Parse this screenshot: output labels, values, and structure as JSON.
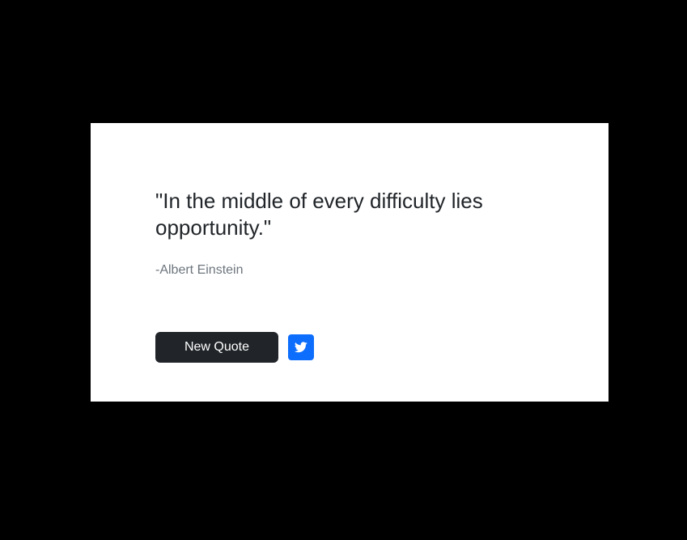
{
  "quote": {
    "text": "\"In the middle of every difficulty lies opportunity.\"",
    "author": "-Albert Einstein"
  },
  "actions": {
    "new_quote_label": "New Quote",
    "tweet_icon": "twitter-icon"
  },
  "colors": {
    "background": "#000000",
    "card": "#ffffff",
    "primary_button": "#212529",
    "tweet_button": "#0d6efd",
    "author_text": "#6c757d"
  }
}
